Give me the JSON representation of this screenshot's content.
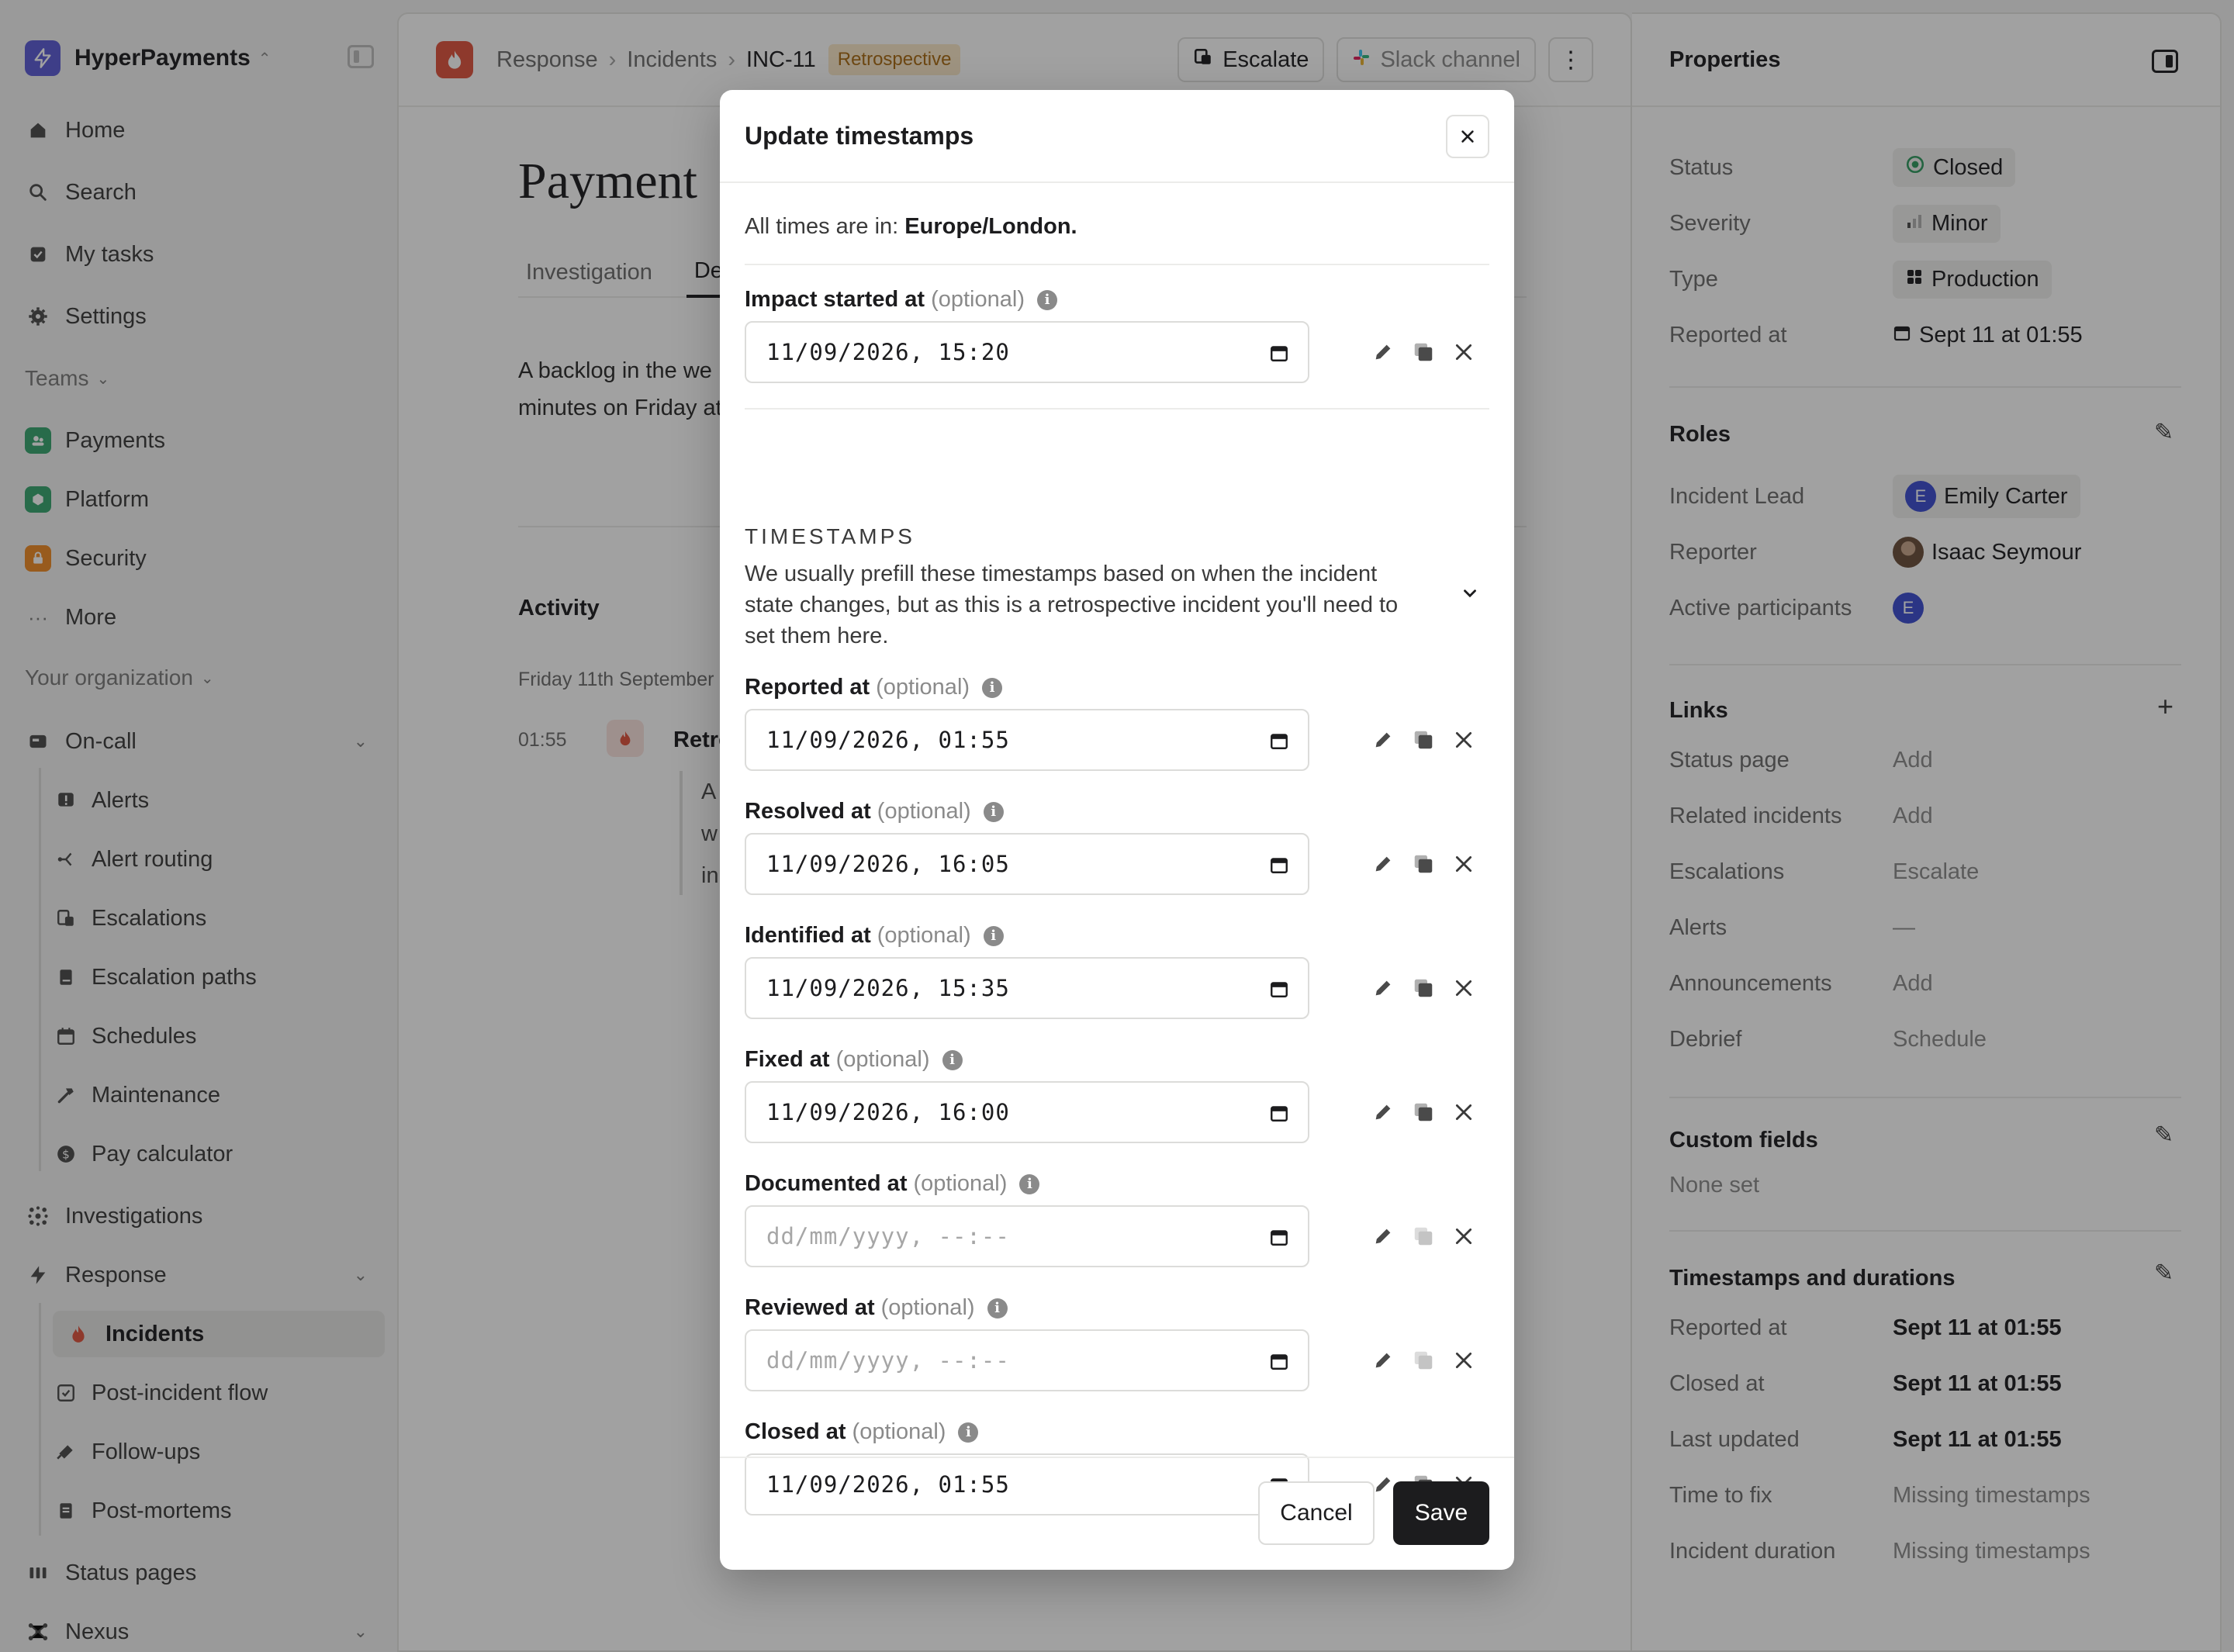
{
  "sidebar": {
    "org_name": "HyperPayments",
    "nav": {
      "home": "Home",
      "search": "Search",
      "my_tasks": "My tasks",
      "settings": "Settings"
    },
    "teams_label": "Teams",
    "teams": [
      "Payments",
      "Platform",
      "Security"
    ],
    "more": "More",
    "org_section_label": "Your organization",
    "oncall": {
      "label": "On-call",
      "items": [
        "Alerts",
        "Alert routing",
        "Escalations",
        "Escalation paths",
        "Schedules",
        "Maintenance",
        "Pay calculator"
      ]
    },
    "investigations": "Investigations",
    "response": {
      "label": "Response",
      "items": [
        "Incidents",
        "Post-incident flow",
        "Follow-ups",
        "Post-mortems"
      ]
    },
    "status_pages": "Status pages",
    "nexus": "Nexus"
  },
  "header": {
    "breadcrumb": [
      "Response",
      "Incidents",
      "INC-11"
    ],
    "badge": "Retrospective",
    "escalate": "Escalate",
    "slack": "Slack channel"
  },
  "incident": {
    "title_visible": "Payment",
    "tabs": [
      "Investigation",
      "Deta"
    ],
    "summary_line1": "A backlog in the we",
    "summary_line2": "minutes on Friday at",
    "activity_title": "Activity",
    "activity_date": "Friday 11th September",
    "activity_time": "01:55",
    "activity_text": "Retro",
    "activity_quote": [
      "A",
      "w",
      "in"
    ]
  },
  "properties": {
    "title": "Properties",
    "status_label": "Status",
    "status": "Closed",
    "severity_label": "Severity",
    "severity": "Minor",
    "type_label": "Type",
    "type": "Production",
    "reported_label": "Reported at",
    "reported": "Sept 11 at 01:55",
    "roles_title": "Roles",
    "lead_label": "Incident Lead",
    "lead": "Emily Carter",
    "lead_initial": "E",
    "reporter_label": "Reporter",
    "reporter": "Isaac Seymour",
    "participants_label": "Active participants",
    "participant_initial": "E",
    "links_title": "Links",
    "links": [
      {
        "label": "Status page",
        "value": "Add"
      },
      {
        "label": "Related incidents",
        "value": "Add"
      },
      {
        "label": "Escalations",
        "value": "Escalate"
      },
      {
        "label": "Alerts",
        "value": "—"
      },
      {
        "label": "Announcements",
        "value": "Add"
      },
      {
        "label": "Debrief",
        "value": "Schedule"
      }
    ],
    "custom_title": "Custom fields",
    "custom_none": "None set",
    "timestamps_title": "Timestamps and durations",
    "ts": [
      {
        "label": "Reported at",
        "value": "Sept 11 at 01:55"
      },
      {
        "label": "Closed at",
        "value": "Sept 11 at 01:55"
      },
      {
        "label": "Last updated",
        "value": "Sept 11 at 01:55"
      },
      {
        "label": "Time to fix",
        "value": "Missing timestamps"
      },
      {
        "label": "Incident duration",
        "value": "Missing timestamps"
      }
    ]
  },
  "modal": {
    "title": "Update timestamps",
    "tz_prefix": "All times are in: ",
    "tz": "Europe/London.",
    "optional": "(optional)",
    "impact_label": "Impact started at",
    "impact_value": "11/09/2026, 15:20",
    "section_heading": "TIMESTAMPS",
    "section_desc": "We usually prefill these timestamps based on when the incident state changes, but as this is a retrospective incident you'll need to set them here.",
    "fields": [
      {
        "label": "Reported at",
        "value": "11/09/2026, 01:55"
      },
      {
        "label": "Resolved at",
        "value": "11/09/2026, 16:05"
      },
      {
        "label": "Identified at",
        "value": "11/09/2026, 15:35"
      },
      {
        "label": "Fixed at",
        "value": "11/09/2026, 16:00"
      },
      {
        "label": "Documented at",
        "value": "dd/mm/yyyy, --:--"
      },
      {
        "label": "Reviewed at",
        "value": "dd/mm/yyyy, --:--"
      },
      {
        "label": "Closed at",
        "value": "11/09/2026, 01:55"
      }
    ],
    "cancel": "Cancel",
    "save": "Save"
  },
  "colors": {
    "accent": "#5b5bd6",
    "incident": "#e0533d",
    "retro_badge_bg": "#fbe8c8",
    "save_bg": "#1c1c1e"
  }
}
